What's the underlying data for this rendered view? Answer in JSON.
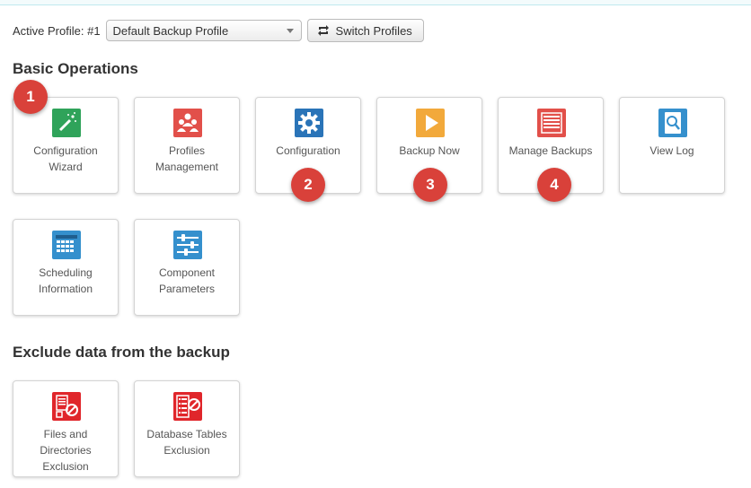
{
  "profile": {
    "active_label": "Active Profile: #1",
    "selected": "Default Backup Profile",
    "switch_label": "Switch Profiles"
  },
  "basic": {
    "heading": "Basic Operations",
    "tiles": [
      {
        "label": "Configuration\nWizard",
        "icon": "magic-wand-icon",
        "color": "#2fa35a"
      },
      {
        "label": "Profiles\nManagement",
        "icon": "users-icon",
        "color": "#e2504a"
      },
      {
        "label": "Configuration",
        "icon": "gear-icon",
        "color": "#2a74b8"
      },
      {
        "label": "Backup Now",
        "icon": "play-icon",
        "color": "#f2a93b"
      },
      {
        "label": "Manage Backups",
        "icon": "list-icon",
        "color": "#e2504a"
      },
      {
        "label": "View Log",
        "icon": "search-document-icon",
        "color": "#3590cd"
      },
      {
        "label": "Scheduling\nInformation",
        "icon": "calendar-icon",
        "color": "#3590cd"
      },
      {
        "label": "Component\nParameters",
        "icon": "sliders-icon",
        "color": "#3590cd"
      }
    ]
  },
  "exclude": {
    "heading": "Exclude data from the backup",
    "tiles": [
      {
        "label": "Files and\nDirectories\nExclusion",
        "icon": "files-exclude-icon",
        "color": "#e0262b"
      },
      {
        "label": "Database Tables\nExclusion",
        "icon": "database-exclude-icon",
        "color": "#e0262b"
      }
    ]
  },
  "badges": [
    "1",
    "2",
    "3",
    "4"
  ]
}
